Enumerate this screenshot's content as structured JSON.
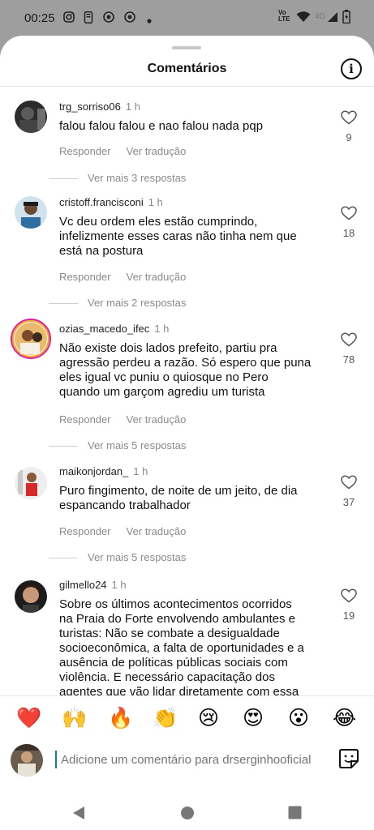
{
  "status_bar": {
    "time": "00:25",
    "network": "4G",
    "volte": "Vo LTE"
  },
  "sheet": {
    "title": "Comentários"
  },
  "comments": [
    {
      "username": "trg_sorriso06",
      "time": "1 h",
      "text_lines": [
        "falou falou falou e nao falou nada pqp"
      ],
      "reply_label": "Responder",
      "translate_label": "Ver tradução",
      "more_replies": "Ver mais 3 respostas",
      "likes": "9"
    },
    {
      "username": "cristoff.francisconi",
      "time": "1 h",
      "text_lines": [
        "Vc deu ordem eles estão cumprindo,",
        "infelizmente esses caras não tinha nem que",
        "está na postura"
      ],
      "reply_label": "Responder",
      "translate_label": "Ver tradução",
      "more_replies": "Ver mais 2 respostas",
      "likes": "18"
    },
    {
      "username": "ozias_macedo_ifec",
      "time": "1 h",
      "text_lines": [
        "Não existe dois lados prefeito, partiu pra",
        "agressão perdeu a razão. Só espero que puna",
        "eles igual vc puniu o quiosque no Pero",
        "quando um garçom agrediu um turista"
      ],
      "reply_label": "Responder",
      "translate_label": "Ver tradução",
      "more_replies": "Ver mais 5 respostas",
      "likes": "78"
    },
    {
      "username": "maikonjordan_",
      "time": "1 h",
      "text_lines": [
        "Puro fingimento,  de noite de um jeito,  de dia",
        "espancando trabalhador"
      ],
      "reply_label": "Responder",
      "translate_label": "Ver tradução",
      "more_replies": "Ver mais 5 respostas",
      "likes": "37"
    },
    {
      "username": "gilmello24",
      "time": "1 h",
      "text_lines": [
        "Sobre os últimos acontecimentos ocorridos",
        "na Praia do Forte envolvendo ambulantes e",
        "turistas: Não se combate a desigualdade",
        "socioeconômica, a falta de oportunidades e a",
        "ausência de políticas públicas sociais com",
        "violência.  E necessário capacitação dos",
        "agentes que vão lidar diretamente  com essa"
      ],
      "likes": "19"
    }
  ],
  "emojis": [
    "❤️",
    "🙌",
    "🔥",
    "👏",
    "😢",
    "😍",
    "😮",
    "😂"
  ],
  "composer": {
    "placeholder": "Adicione um comentário para drserginhooficial"
  },
  "colors": {
    "heart": "#e0245e",
    "cursor": "#1a7f7f",
    "story_ring": "#d6249f"
  }
}
